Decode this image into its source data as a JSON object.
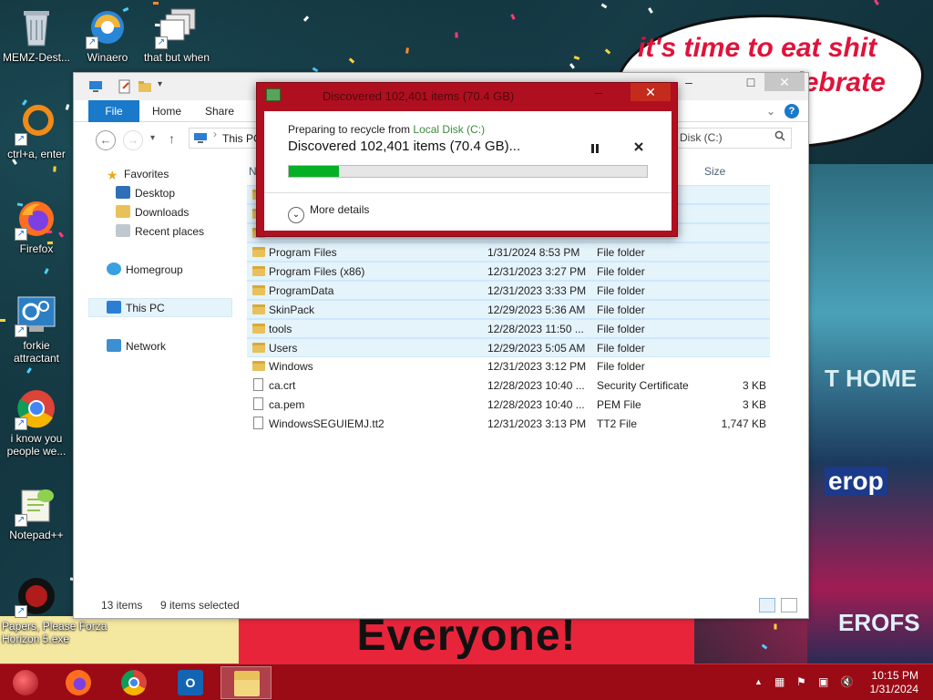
{
  "wallpaper": {
    "bubble_line1": "it's time to eat shit",
    "bubble_line2": "celebrate",
    "banner_text": "Everyone!",
    "city_sign_1": "T HOME",
    "city_sign_2": "erop",
    "city_sign_3": "EROFS"
  },
  "desktop_icons": [
    {
      "label": "MEMZ-Dest...",
      "icon": "recycle-bin-icon"
    },
    {
      "label": "Winaero",
      "icon": "winaero-icon"
    },
    {
      "label": "that but when",
      "icon": "windows-stack-icon"
    },
    {
      "label": "ctrl+a, enter",
      "icon": "ring-icon"
    },
    {
      "label": "Firefox",
      "icon": "firefox-icon"
    },
    {
      "label": "forkie attractant",
      "icon": "settings-icon"
    },
    {
      "label": "i know you people we...",
      "icon": "chrome-icon"
    },
    {
      "label": "Notepad++",
      "icon": "notepad-plus-plus-icon"
    },
    {
      "label": "Papers, Please Forza Horizon 5.exe",
      "icon": "papers-please-icon"
    }
  ],
  "explorer": {
    "tabs": {
      "file": "File",
      "home": "Home",
      "share": "Share"
    },
    "address": "This PC",
    "search_placeholder": "Disk (C:)",
    "nav": {
      "favorites": "Favorites",
      "desktop": "Desktop",
      "downloads": "Downloads",
      "recent": "Recent places",
      "homegroup": "Homegroup",
      "this_pc": "This PC",
      "network": "Network"
    },
    "columns": {
      "name": "N",
      "size": "Size"
    },
    "files": [
      {
        "name": "Program Files",
        "date": "1/31/2024 8:53 PM",
        "type": "File folder",
        "size": "",
        "selected": true
      },
      {
        "name": "Program Files (x86)",
        "date": "12/31/2023 3:27 PM",
        "type": "File folder",
        "size": "",
        "selected": true
      },
      {
        "name": "ProgramData",
        "date": "12/31/2023 3:33 PM",
        "type": "File folder",
        "size": "",
        "selected": true
      },
      {
        "name": "SkinPack",
        "date": "12/29/2023 5:36 AM",
        "type": "File folder",
        "size": "",
        "selected": true
      },
      {
        "name": "tools",
        "date": "12/28/2023 11:50 ...",
        "type": "File folder",
        "size": "",
        "selected": true
      },
      {
        "name": "Users",
        "date": "12/29/2023 5:05 AM",
        "type": "File folder",
        "size": "",
        "selected": true
      },
      {
        "name": "Windows",
        "date": "12/31/2023 3:12 PM",
        "type": "File folder",
        "size": "",
        "selected": false
      },
      {
        "name": "ca.crt",
        "date": "12/28/2023 10:40 ...",
        "type": "Security Certificate",
        "size": "3 KB",
        "selected": false
      },
      {
        "name": "ca.pem",
        "date": "12/28/2023 10:40 ...",
        "type": "PEM File",
        "size": "3 KB",
        "selected": false
      },
      {
        "name": "WindowsSEGUIEMJ.tt2",
        "date": "12/31/2023 3:13 PM",
        "type": "TT2 File",
        "size": "1,747 KB",
        "selected": false
      }
    ],
    "status": {
      "count": "13 items",
      "selected": "9 items selected"
    }
  },
  "dialog": {
    "title": "Discovered 102,401 items (70.4 GB)",
    "preparing_prefix": "Preparing to recycle from ",
    "source_link": "Local Disk (C:)",
    "main_text": "Discovered 102,401 items (70.4 GB)...",
    "progress_percent": 14,
    "more_details": "More details",
    "close_glyph": "✕"
  },
  "taskbar": {
    "time": "10:15 PM",
    "date": "1/31/2024",
    "apps": [
      "start-orb-icon",
      "firefox-icon",
      "chrome-icon",
      "outlook-icon",
      "file-explorer-icon"
    ]
  },
  "colors": {
    "accent_red": "#b00f1f",
    "taskbar_red": "#9a0b16",
    "ribbon_blue": "#1979ca",
    "progress_green": "#06b025"
  }
}
